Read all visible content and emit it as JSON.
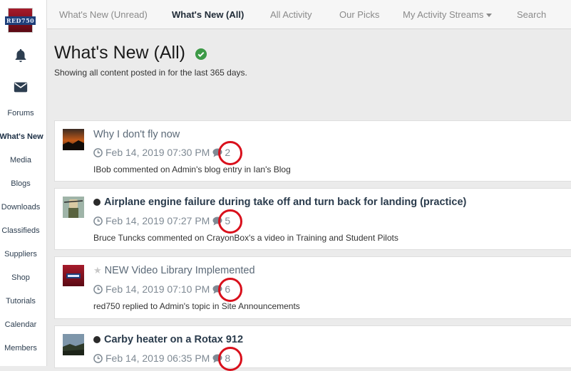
{
  "sidebar": {
    "logo_text": "RED750",
    "items": [
      {
        "label": "Forums"
      },
      {
        "label": "What's New"
      },
      {
        "label": "Media"
      },
      {
        "label": "Blogs"
      },
      {
        "label": "Downloads"
      },
      {
        "label": "Classifieds"
      },
      {
        "label": "Suppliers"
      },
      {
        "label": "Shop"
      },
      {
        "label": "Tutorials"
      },
      {
        "label": "Calendar"
      },
      {
        "label": "Members"
      }
    ]
  },
  "topnav": {
    "tabs": [
      {
        "label": "What's New (Unread)"
      },
      {
        "label": "What's New (All)"
      },
      {
        "label": "All Activity"
      },
      {
        "label": "Our Picks"
      },
      {
        "label": "My Activity Streams"
      },
      {
        "label": "Search"
      }
    ]
  },
  "header": {
    "title": "What's New (All)",
    "subtitle": "Showing all content posted in for the last 365 days."
  },
  "feed": [
    {
      "title": "Why I don't fly now",
      "state": "read",
      "date": "Feb 14, 2019 07:30 PM",
      "count": "2",
      "description": "IBob commented on Admin's blog entry in Ian's Blog"
    },
    {
      "title": "Airplane engine failure during take off and turn back for landing (practice)",
      "state": "unread",
      "date": "Feb 14, 2019 07:27 PM",
      "count": "5",
      "description": "Bruce Tuncks commented on CrayonBox's a video in Training and Student Pilots"
    },
    {
      "title": "NEW Video Library Implemented",
      "state": "starred",
      "date": "Feb 14, 2019 07:10 PM",
      "count": "6",
      "description": "red750 replied to Admin's topic in Site Announcements"
    },
    {
      "title": "Carby heater on a Rotax 912",
      "state": "unread",
      "date": "Feb 14, 2019 06:35 PM",
      "count": "8",
      "description": ""
    }
  ],
  "colors": {
    "highlight_ring": "#d9101c",
    "verified_check": "#3d9a47"
  }
}
